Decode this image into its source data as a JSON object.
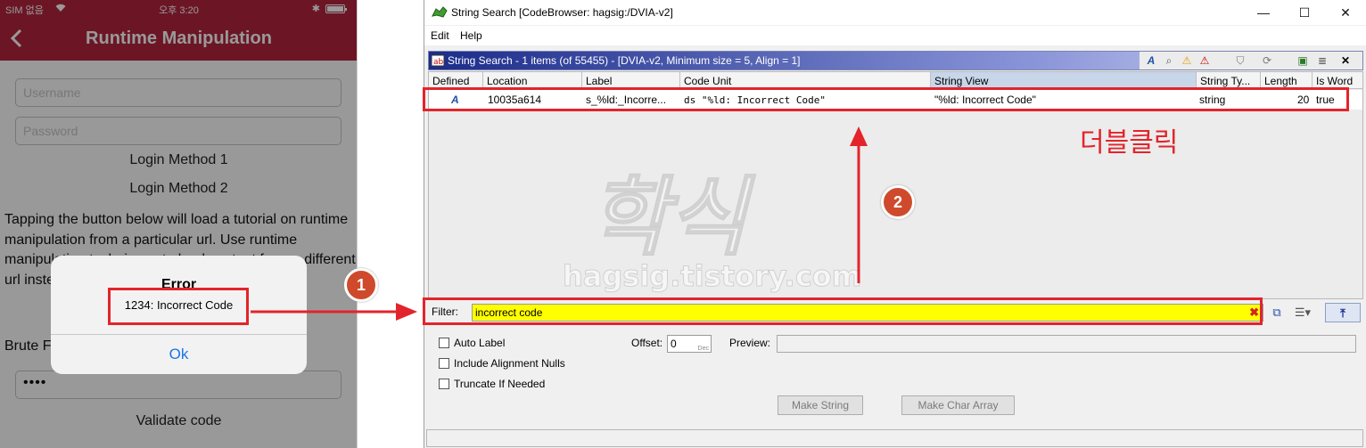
{
  "phone": {
    "status": {
      "carrier": "SIM 없음",
      "time": "오후 3:20"
    },
    "nav": {
      "title": "Runtime Manipulation"
    },
    "username_placeholder": "Username",
    "password_placeholder": "Password",
    "login_method_1": "Login Method 1",
    "login_method_2": "Login Method 2",
    "paragraph": "Tapping the button below will load a tutorial on runtime manipulation from a particular url. Use runtime manipulation techniques to load content from a different url instead of the one given in the app.",
    "brute_label": "Brute F",
    "pin_value": "••••",
    "validate_button": "Validate code",
    "alert": {
      "title": "Error",
      "message": "1234: Incorrect Code",
      "ok": "Ok"
    }
  },
  "ghidra": {
    "window_title": "String Search [CodeBrowser: hagsig:/DVIA-v2]",
    "window_controls": {
      "minimize": "—",
      "maximize": "☐",
      "close": "✕"
    },
    "menu": [
      "Edit",
      "Help"
    ],
    "panel_title": "String Search - 1 items (of 55455) - [DVIA-v2, Minimum size = 5, Align = 1]",
    "columns": [
      "Defined",
      "Location",
      "Label",
      "Code Unit",
      "String View",
      "String Ty...",
      "Length",
      "Is Word"
    ],
    "rows": [
      {
        "defined_icon": "A",
        "location": "10035a614",
        "label": "s_%ld:_Incorre...",
        "code_unit": "ds \"%ld: Incorrect Code\"",
        "string_view": "\"%ld: Incorrect Code\"",
        "string_type": "string",
        "length": "20",
        "is_word": "true"
      }
    ],
    "filter": {
      "label": "Filter:",
      "value": "incorrect code"
    },
    "options": {
      "auto_label": "Auto Label",
      "include_alignment_nulls": "Include Alignment Nulls",
      "truncate_if_needed": "Truncate If Needed",
      "offset_label": "Offset:",
      "offset_value": "0",
      "offset_unit": "Dec",
      "preview_label": "Preview:"
    },
    "buttons": {
      "make_string": "Make String",
      "make_char_array": "Make Char Array"
    }
  },
  "annotations": {
    "step1": "1",
    "step2": "2",
    "note": "더블클릭"
  },
  "watermark": {
    "logo": "학식",
    "url": "hagsig.tistory.com"
  },
  "colors": {
    "nav_bar": "#b5253f",
    "highlight": "#e3242b",
    "badge": "#cf4a2c",
    "filter_bg": "#ffff00",
    "panel_title_dark": "#1b2c8a"
  }
}
